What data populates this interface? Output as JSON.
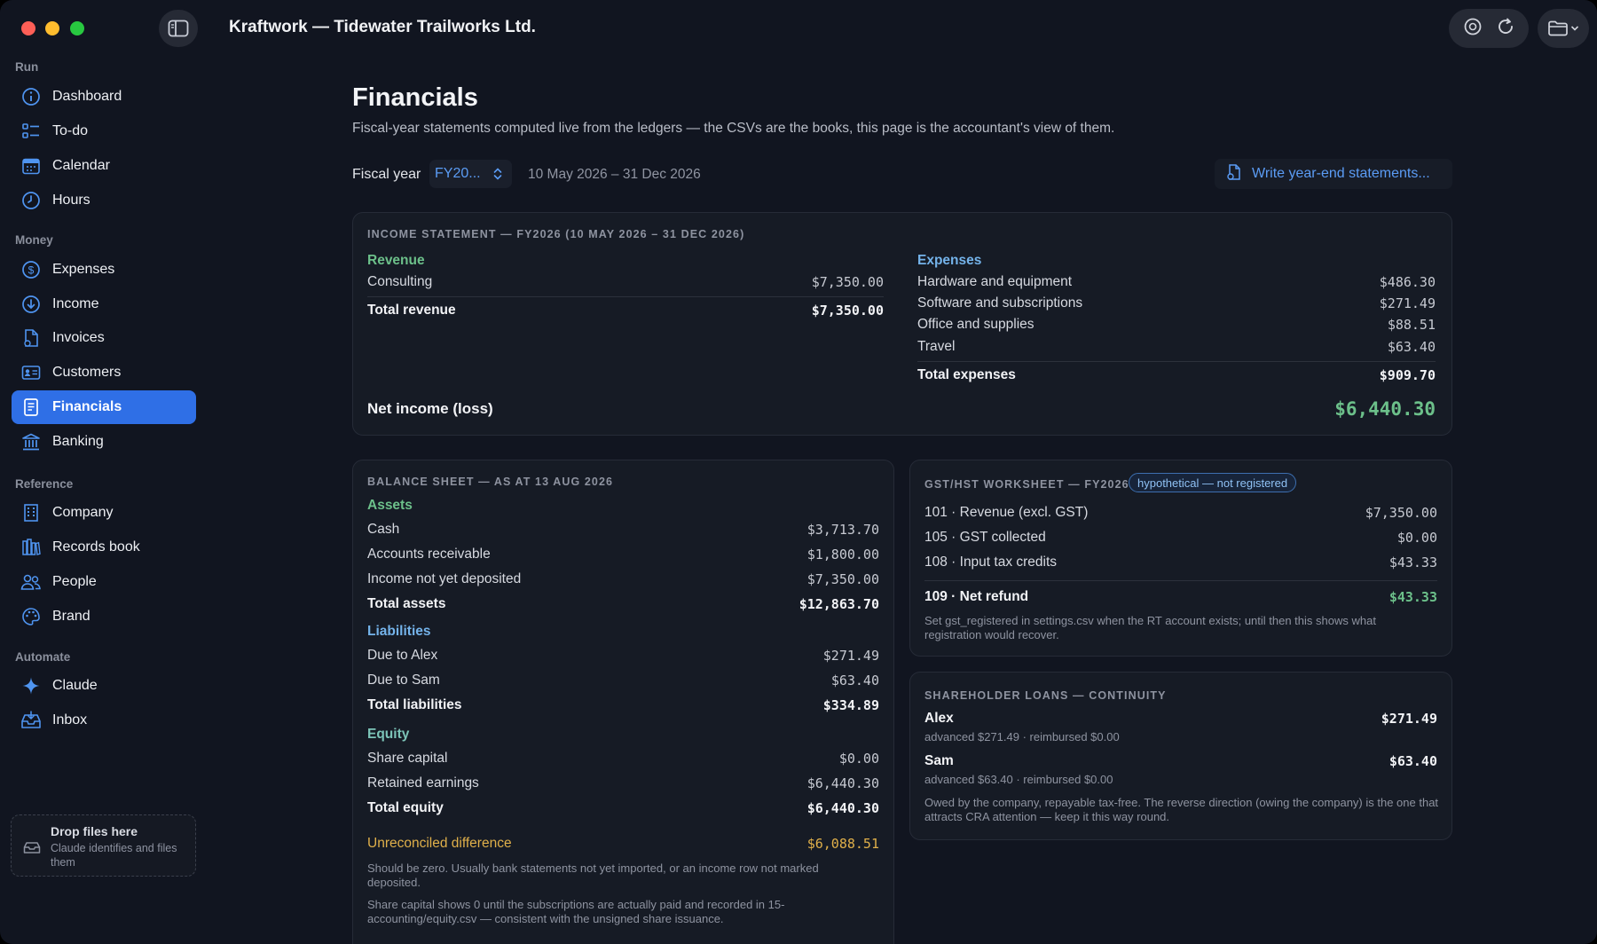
{
  "app": {
    "title": "Kraftwork — Tidewater Trailworks Ltd."
  },
  "sidebar": {
    "sections": [
      {
        "label": "Run"
      },
      {
        "label": "Money"
      },
      {
        "label": "Reference"
      },
      {
        "label": "Automate"
      }
    ],
    "items": [
      {
        "label": "Dashboard",
        "icon": "dashboard-icon"
      },
      {
        "label": "To-do",
        "icon": "todo-icon"
      },
      {
        "label": "Calendar",
        "icon": "calendar-icon"
      },
      {
        "label": "Hours",
        "icon": "clock-icon"
      },
      {
        "label": "Expenses",
        "icon": "dollar-icon"
      },
      {
        "label": "Income",
        "icon": "arrow-down-circle-icon"
      },
      {
        "label": "Invoices",
        "icon": "invoice-icon"
      },
      {
        "label": "Customers",
        "icon": "contact-card-icon"
      },
      {
        "label": "Financials",
        "icon": "document-icon",
        "active": true
      },
      {
        "label": "Banking",
        "icon": "bank-icon"
      },
      {
        "label": "Company",
        "icon": "building-icon"
      },
      {
        "label": "Records book",
        "icon": "books-icon"
      },
      {
        "label": "People",
        "icon": "people-icon"
      },
      {
        "label": "Brand",
        "icon": "palette-icon"
      },
      {
        "label": "Claude",
        "icon": "sparkle-icon"
      },
      {
        "label": "Inbox",
        "icon": "inbox-icon"
      }
    ],
    "dropzone": {
      "title": "Drop files here",
      "subtitle": "Claude identifies and files them"
    }
  },
  "page": {
    "title": "Financials",
    "subtitle": "Fiscal-year statements computed live from the ledgers — the CSVs are the books, this page is the accountant's view of them.",
    "fiscal_year_label": "Fiscal year",
    "fiscal_year_value": "FY20...",
    "date_range": "10 May 2026 – 31 Dec 2026",
    "write_button": "Write year-end statements..."
  },
  "income_statement": {
    "title": "INCOME STATEMENT — FY2026 (10 MAY 2026 – 31 DEC 2026)",
    "revenue_head": "Revenue",
    "revenue_rows": [
      {
        "label": "Consulting",
        "amount": "$7,350.00"
      }
    ],
    "total_revenue": {
      "label": "Total revenue",
      "amount": "$7,350.00"
    },
    "expenses_head": "Expenses",
    "expense_rows": [
      {
        "label": "Hardware and equipment",
        "amount": "$486.30"
      },
      {
        "label": "Software and subscriptions",
        "amount": "$271.49"
      },
      {
        "label": "Office and supplies",
        "amount": "$88.51"
      },
      {
        "label": "Travel",
        "amount": "$63.40"
      }
    ],
    "total_expenses": {
      "label": "Total expenses",
      "amount": "$909.70"
    },
    "net_income": {
      "label": "Net income (loss)",
      "amount": "$6,440.30"
    }
  },
  "balance_sheet": {
    "title": "BALANCE SHEET — AS AT 13 AUG 2026",
    "assets_head": "Assets",
    "assets": [
      {
        "label": "Cash",
        "amount": "$3,713.70"
      },
      {
        "label": "Accounts receivable",
        "amount": "$1,800.00"
      },
      {
        "label": "Income not yet deposited",
        "amount": "$7,350.00"
      }
    ],
    "total_assets": {
      "label": "Total assets",
      "amount": "$12,863.70"
    },
    "liabilities_head": "Liabilities",
    "liabilities": [
      {
        "label": "Due to Alex",
        "amount": "$271.49"
      },
      {
        "label": "Due to Sam",
        "amount": "$63.40"
      }
    ],
    "total_liabilities": {
      "label": "Total liabilities",
      "amount": "$334.89"
    },
    "equity_head": "Equity",
    "equity": [
      {
        "label": "Share capital",
        "amount": "$0.00"
      },
      {
        "label": "Retained earnings",
        "amount": "$6,440.30"
      }
    ],
    "total_equity": {
      "label": "Total equity",
      "amount": "$6,440.30"
    },
    "unreconciled": {
      "label": "Unreconciled difference",
      "amount": "$6,088.51"
    },
    "note1": "Should be zero. Usually bank statements not yet imported, or an income row not marked deposited.",
    "note2": "Share capital shows 0 until the subscriptions are actually paid and recorded in 15-accounting/equity.csv — consistent with the unsigned share issuance."
  },
  "gst": {
    "title": "GST/HST WORKSHEET — FY2026",
    "badge": "hypothetical — not registered",
    "rows": [
      {
        "label": "101 · Revenue (excl. GST)",
        "amount": "$7,350.00"
      },
      {
        "label": "105 · GST collected",
        "amount": "$0.00"
      },
      {
        "label": "108 · Input tax credits",
        "amount": "$43.33"
      }
    ],
    "net": {
      "label": "109 · Net refund",
      "amount": "$43.33"
    },
    "note": "Set gst_registered in settings.csv when the RT account exists; until then this shows what registration would recover."
  },
  "loans": {
    "title": "SHAREHOLDER LOANS — CONTINUITY",
    "people": [
      {
        "name": "Alex",
        "amount": "$271.49",
        "detail": "advanced $271.49 · reimbursed $0.00"
      },
      {
        "name": "Sam",
        "amount": "$63.40",
        "detail": "advanced $63.40 · reimbursed $0.00"
      }
    ],
    "note": "Owed by the company, repayable tax-free. The reverse direction (owing the company) is the one that attracts CRA attention — keep it this way round."
  },
  "colors": {
    "accent": "#2f6fe6",
    "link": "#5b9cf5",
    "positive": "#6cc08a",
    "warning": "#e0b04a",
    "background": "#111520"
  }
}
